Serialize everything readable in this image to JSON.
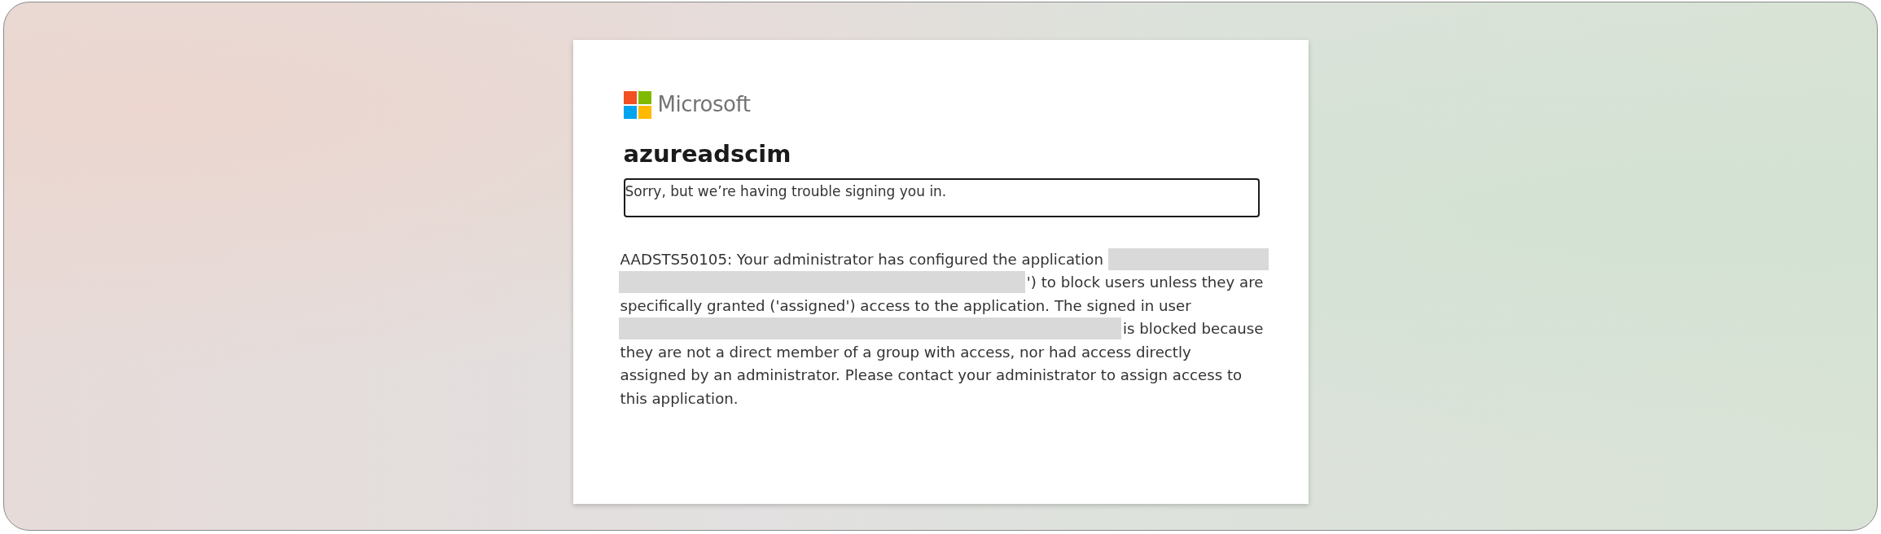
{
  "brand": {
    "name": "Microsoft"
  },
  "title": "azureadscim",
  "notice": "Sorry, but we’re having trouble signing you in.",
  "message_lines": [
    {
      "parts": [
        {
          "kind": "text",
          "text": "AADSTS50105: Your administrator has configured the application"
        },
        {
          "kind": "redacted"
        }
      ]
    },
    {
      "parts": [
        {
          "kind": "redacted"
        },
        {
          "kind": "text",
          "text": "') to block users unless they are"
        }
      ]
    },
    {
      "parts": [
        {
          "kind": "text",
          "text": "specifically granted ('assigned') access to the application. The signed in user"
        }
      ]
    },
    {
      "parts": [
        {
          "kind": "redacted"
        },
        {
          "kind": "text",
          "text": "is blocked because"
        }
      ]
    },
    {
      "parts": [
        {
          "kind": "text",
          "text": "they are not a direct member of a group with access, nor had access directly"
        }
      ]
    },
    {
      "parts": [
        {
          "kind": "text",
          "text": "assigned by an administrator. Please contact your administrator to assign access to"
        }
      ]
    },
    {
      "parts": [
        {
          "kind": "text",
          "text": "this application."
        }
      ]
    }
  ]
}
